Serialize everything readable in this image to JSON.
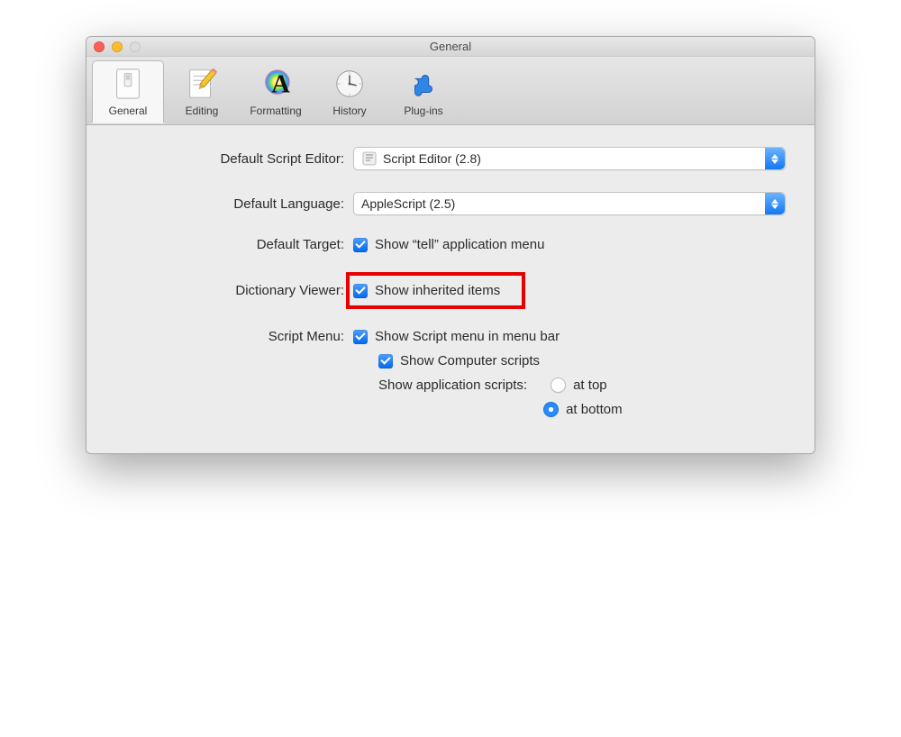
{
  "window": {
    "title": "General"
  },
  "toolbar": {
    "items": [
      {
        "label": "General",
        "id": "general"
      },
      {
        "label": "Editing",
        "id": "editing"
      },
      {
        "label": "Formatting",
        "id": "formatting"
      },
      {
        "label": "History",
        "id": "history"
      },
      {
        "label": "Plug-ins",
        "id": "plugins"
      }
    ],
    "selected": "general"
  },
  "prefs": {
    "default_script_editor": {
      "label": "Default Script Editor:",
      "value": "Script Editor (2.8)"
    },
    "default_language": {
      "label": "Default Language:",
      "value": "AppleScript (2.5)"
    },
    "default_target": {
      "label": "Default Target:",
      "checkbox_label": "Show “tell” application menu",
      "checked": true
    },
    "dictionary_viewer": {
      "label": "Dictionary Viewer:",
      "checkbox_label": "Show inherited items",
      "checked": true
    },
    "script_menu": {
      "label": "Script Menu:",
      "show_in_menu_bar": {
        "label": "Show Script menu in menu bar",
        "checked": true
      },
      "show_computer_scripts": {
        "label": "Show Computer scripts",
        "checked": true
      },
      "app_scripts": {
        "label": "Show application scripts:",
        "at_top": {
          "label": "at top",
          "selected": false
        },
        "at_bottom": {
          "label": "at bottom",
          "selected": true
        }
      }
    }
  },
  "highlight": {
    "target": "dictionary-viewer-row"
  }
}
